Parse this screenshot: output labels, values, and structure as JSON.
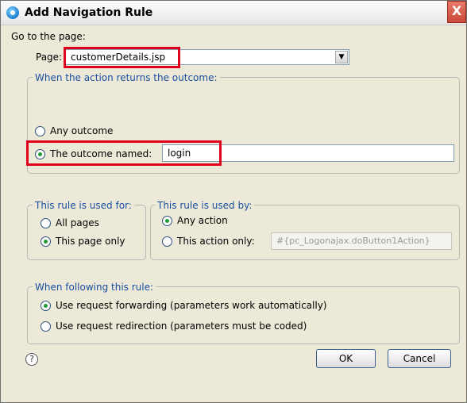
{
  "window": {
    "title": "Add Navigation Rule",
    "close_label": "X"
  },
  "page_section": {
    "heading": "Go to the page:",
    "page_label": "Page:",
    "page_value": "customerDetails.jsp"
  },
  "outcome_group": {
    "legend": "When the action returns the outcome:",
    "any_outcome": "Any outcome",
    "outcome_named": "The outcome named:",
    "outcome_value": "login",
    "selected": "outcome_named"
  },
  "used_for_group": {
    "legend": "This rule is used for:",
    "all_pages": "All pages",
    "this_page_only": "This page only",
    "selected": "this_page_only"
  },
  "used_by_group": {
    "legend": "This rule is used by:",
    "any_action": "Any action",
    "this_action_only": "This action only:",
    "action_value": "#{pc_Logonajax.doButton1Action}",
    "selected": "any_action"
  },
  "following_group": {
    "legend": "When following this rule:",
    "forwarding": "Use request forwarding (parameters work automatically)",
    "redirection": "Use request redirection (parameters must be coded)",
    "selected": "forwarding"
  },
  "footer": {
    "help_glyph": "?",
    "ok_label": "OK",
    "cancel_label": "Cancel"
  },
  "colors": {
    "highlight": "#e0001b",
    "legend_text": "#1a4fa0",
    "radio_dot": "#1e9c36"
  }
}
